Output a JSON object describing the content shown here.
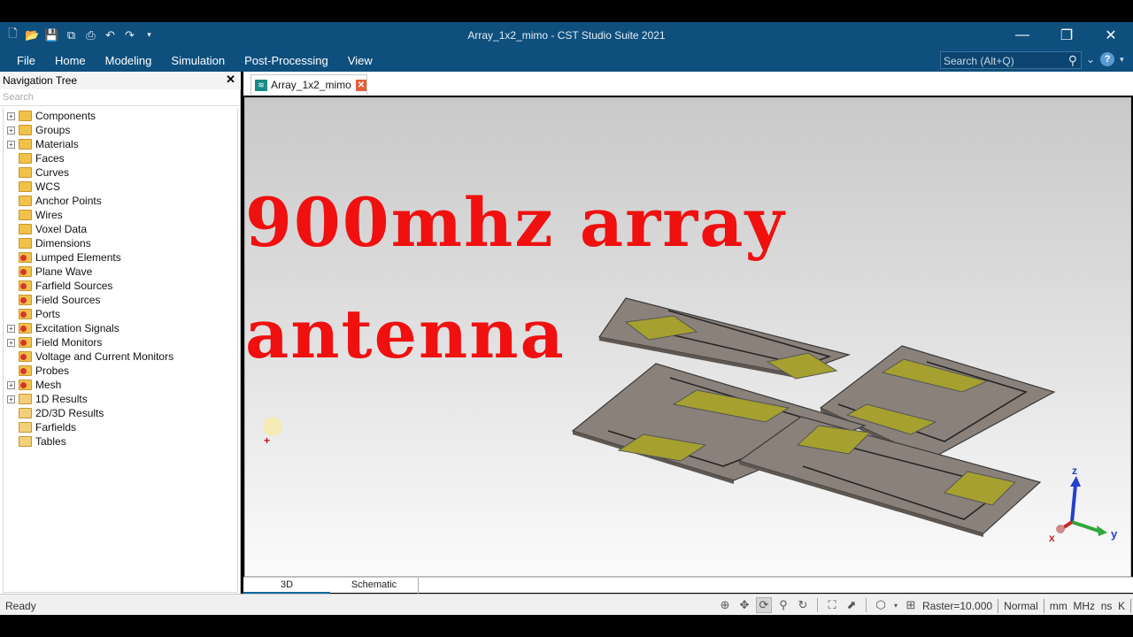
{
  "window": {
    "title": "Array_1x2_mimo - CST Studio Suite 2021",
    "controls": {
      "minimize": "—",
      "restore": "❐",
      "close": "✕"
    }
  },
  "quick_access": [
    "new-file-icon",
    "open-folder-icon",
    "save-icon",
    "save-all-icon",
    "print-icon",
    "undo-icon",
    "redo-icon",
    "customize-icon"
  ],
  "menu": {
    "items": [
      "File",
      "Home",
      "Modeling",
      "Simulation",
      "Post-Processing",
      "View"
    ],
    "search_placeholder": "Search (Alt+Q)"
  },
  "nav_tree": {
    "title": "Navigation Tree",
    "search_placeholder": "Search",
    "items": [
      {
        "label": "Components",
        "expandable": true,
        "icon": "folder"
      },
      {
        "label": "Groups",
        "expandable": true,
        "icon": "folder"
      },
      {
        "label": "Materials",
        "expandable": true,
        "icon": "folder"
      },
      {
        "label": "Faces",
        "expandable": false,
        "icon": "folder"
      },
      {
        "label": "Curves",
        "expandable": false,
        "icon": "folder"
      },
      {
        "label": "WCS",
        "expandable": false,
        "icon": "folder"
      },
      {
        "label": "Anchor Points",
        "expandable": false,
        "icon": "folder"
      },
      {
        "label": "Wires",
        "expandable": false,
        "icon": "folder"
      },
      {
        "label": "Voxel Data",
        "expandable": false,
        "icon": "folder"
      },
      {
        "label": "Dimensions",
        "expandable": false,
        "icon": "folder"
      },
      {
        "label": "Lumped Elements",
        "expandable": false,
        "icon": "red-folder"
      },
      {
        "label": "Plane Wave",
        "expandable": false,
        "icon": "red-folder"
      },
      {
        "label": "Farfield Sources",
        "expandable": false,
        "icon": "red-folder"
      },
      {
        "label": "Field Sources",
        "expandable": false,
        "icon": "red-folder"
      },
      {
        "label": "Ports",
        "expandable": false,
        "icon": "red-folder"
      },
      {
        "label": "Excitation Signals",
        "expandable": true,
        "icon": "red-folder"
      },
      {
        "label": "Field Monitors",
        "expandable": true,
        "icon": "red-folder"
      },
      {
        "label": "Voltage and Current Monitors",
        "expandable": false,
        "icon": "red-folder"
      },
      {
        "label": "Probes",
        "expandable": false,
        "icon": "red-folder"
      },
      {
        "label": "Mesh",
        "expandable": true,
        "icon": "red-folder"
      },
      {
        "label": "1D Results",
        "expandable": true,
        "icon": "plain-folder"
      },
      {
        "label": "2D/3D Results",
        "expandable": false,
        "icon": "plain-folder"
      },
      {
        "label": "Farfields",
        "expandable": false,
        "icon": "plain-folder"
      },
      {
        "label": "Tables",
        "expandable": false,
        "icon": "plain-folder"
      }
    ]
  },
  "doc_tab": {
    "label": "Array_1x2_mimo",
    "close": "✕"
  },
  "viewport": {
    "overlay_line1": "900mhz array",
    "overlay_line2": "antenna",
    "axes": {
      "x": "x",
      "y": "y",
      "z": "z"
    },
    "colors": {
      "substrate": "#8a817a",
      "patch": "#a6a030",
      "overlay_text": "#f01010"
    }
  },
  "view_tabs": [
    "3D",
    "Schematic"
  ],
  "status": {
    "text": "Ready",
    "icons": [
      "zoom-region-icon",
      "pan-icon",
      "rotate-icon",
      "zoom-icon",
      "spin-icon",
      "fit-view-icon",
      "select-icon",
      "view-cube-icon",
      "grid-snap-icon"
    ],
    "raster": "Raster=10.000",
    "mode": "Normal",
    "units": "mm  MHz  ns  K"
  }
}
